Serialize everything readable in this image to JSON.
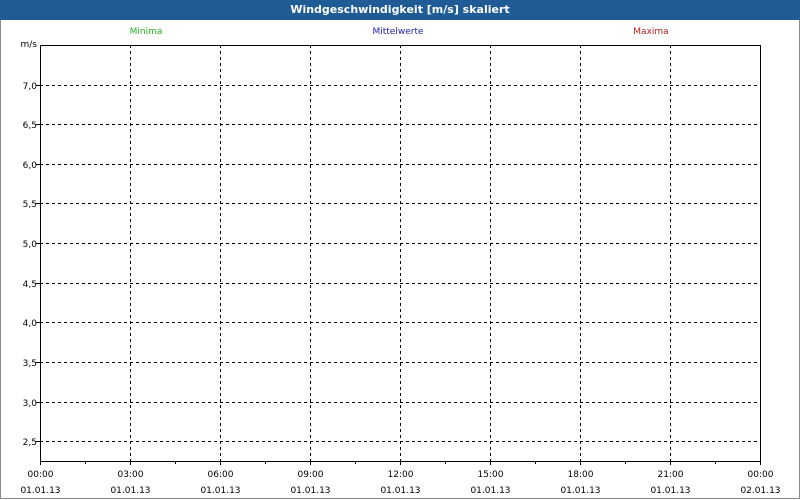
{
  "window": {
    "title": "Windgeschwindigkeit [m/s] skaliert"
  },
  "legend": [
    {
      "label": "Minima",
      "color": "#22b022"
    },
    {
      "label": "Mittelwerte",
      "color": "#2222b0"
    },
    {
      "label": "Maxima",
      "color": "#b02222"
    }
  ],
  "chart_data": {
    "type": "line",
    "title": "Windgeschwindigkeit [m/s] skaliert",
    "ylabel": "m/s",
    "xlabel": "",
    "ylim": [
      2.25,
      7.5
    ],
    "y_ticks": [
      "7,0",
      "6,5",
      "6,0",
      "5,5",
      "5,0",
      "4,5",
      "4,0",
      "3,5",
      "3,0",
      "2,5"
    ],
    "y_tick_values": [
      7.0,
      6.5,
      6.0,
      5.5,
      5.0,
      4.5,
      4.0,
      3.5,
      3.0,
      2.5
    ],
    "x_range": [
      "01.01.13 00:00",
      "02.01.13 00:00"
    ],
    "x_ticks": [
      {
        "time": "00:00",
        "date": "01.01.13"
      },
      {
        "time": "03:00",
        "date": "01.01.13"
      },
      {
        "time": "06:00",
        "date": "01.01.13"
      },
      {
        "time": "09:00",
        "date": "01.01.13"
      },
      {
        "time": "12:00",
        "date": "01.01.13"
      },
      {
        "time": "15:00",
        "date": "01.01.13"
      },
      {
        "time": "18:00",
        "date": "01.01.13"
      },
      {
        "time": "21:00",
        "date": "01.01.13"
      },
      {
        "time": "00:00",
        "date": "02.01.13"
      }
    ],
    "grid": true,
    "series": [
      {
        "name": "Minima",
        "color": "#22b022",
        "values": []
      },
      {
        "name": "Mittelwerte",
        "color": "#2222b0",
        "values": []
      },
      {
        "name": "Maxima",
        "color": "#b02222",
        "values": []
      }
    ]
  }
}
